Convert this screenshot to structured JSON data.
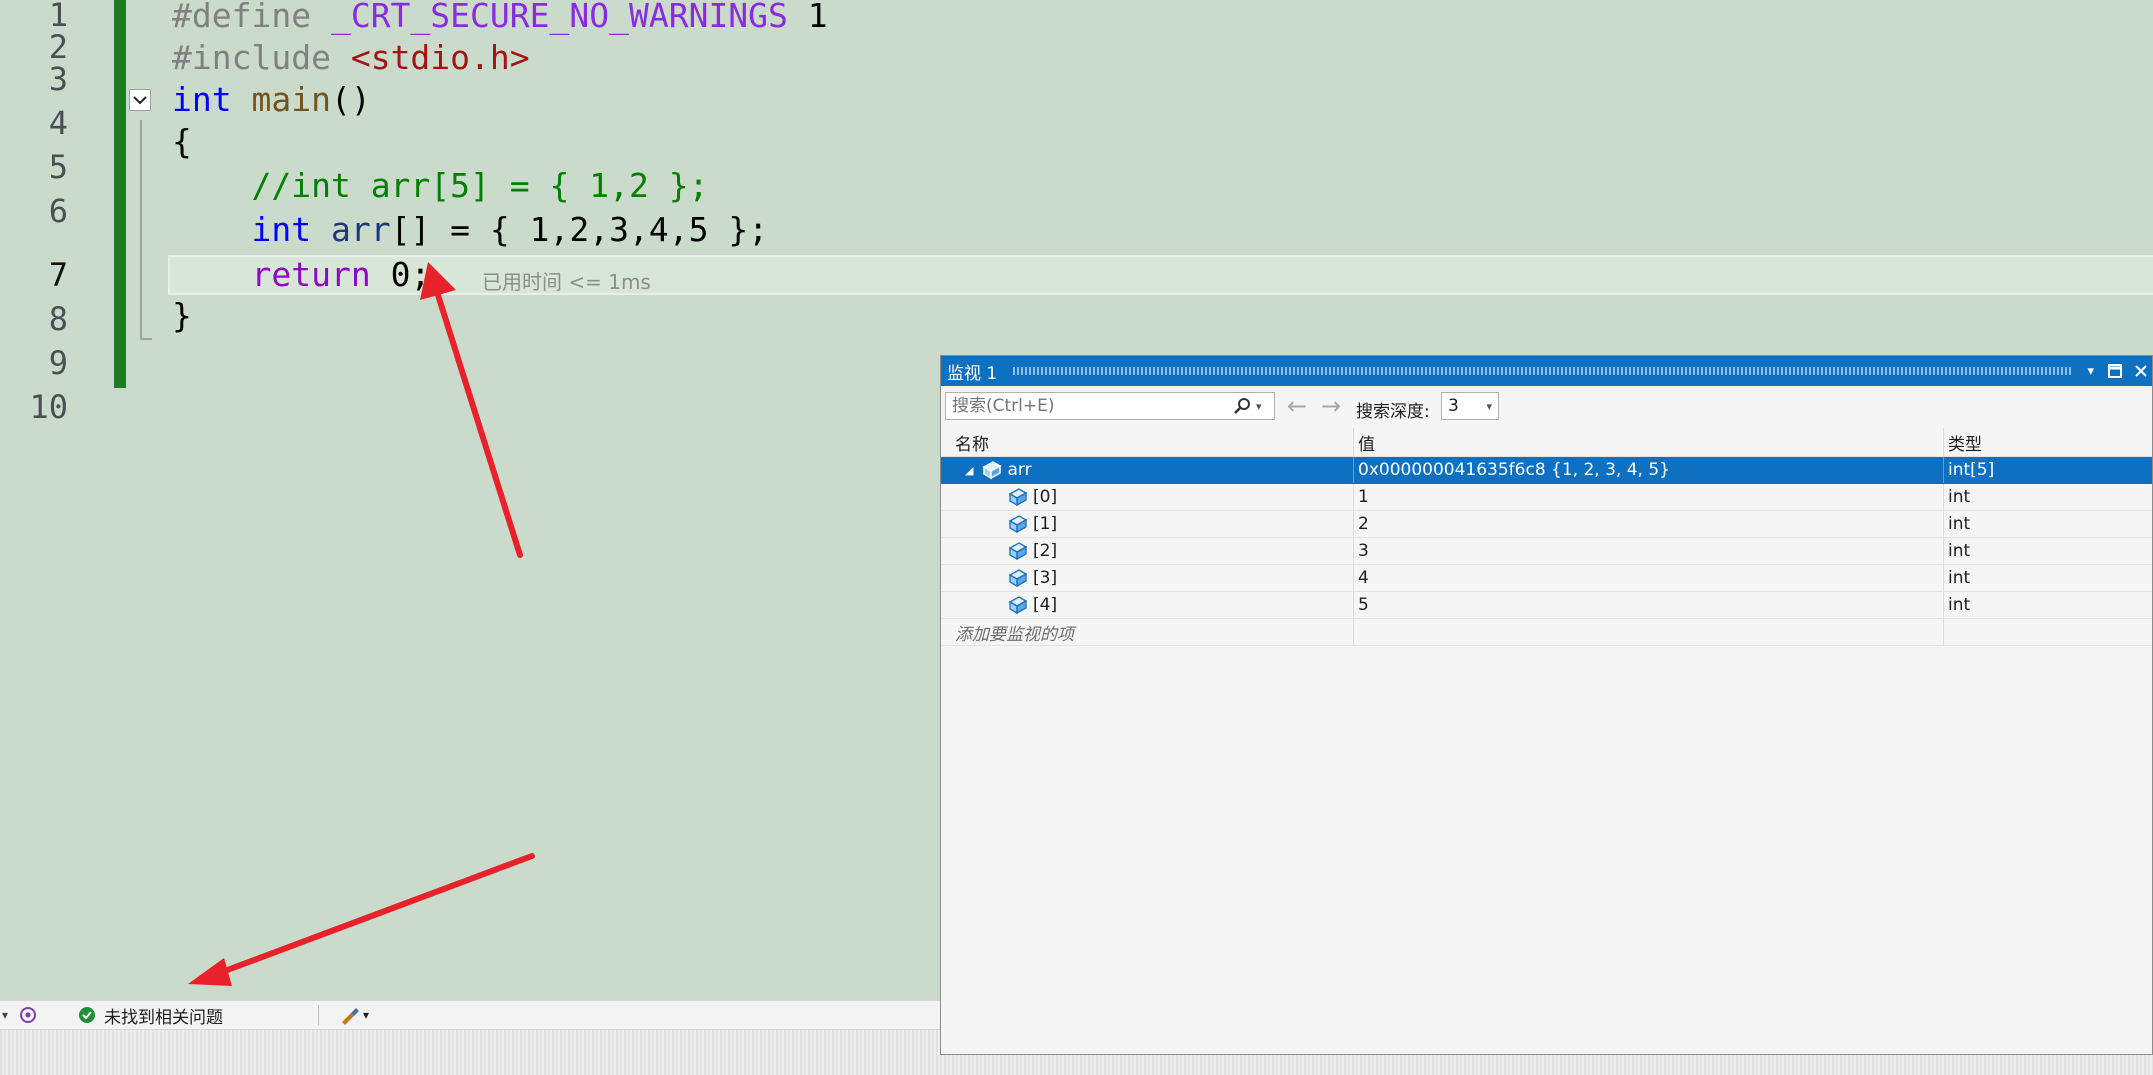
{
  "editor": {
    "line_numbers": [
      "1",
      "2",
      "3",
      "4",
      "5",
      "6",
      "7",
      "8",
      "9",
      "10"
    ],
    "current_line": "7",
    "code": {
      "l1_directive": "#define",
      "l1_macro": "_CRT_SECURE_NO_WARNINGS",
      "l1_value": "1",
      "l2_directive": "#include",
      "l2_header": "<stdio.h>",
      "l3_type": "int",
      "l3_func": "main",
      "l3_parens": "()",
      "l4": "{",
      "l5_comment": "//int arr[5] = { 1,2 };",
      "l6_type": "int",
      "l6_var": "arr",
      "l6_rest": "[] = { 1,2,3,4,5 };",
      "l7_keyword": "return",
      "l7_rest": "0;",
      "l8": "}"
    },
    "elapsed_hint": "已用时间 <= 1ms"
  },
  "status_bar": {
    "issues_text": "未找到相关问题"
  },
  "watch": {
    "title": "监视 1",
    "search_placeholder": "搜索(Ctrl+E)",
    "depth_label": "搜索深度:",
    "depth_value": "3",
    "columns": {
      "name": "名称",
      "value": "值",
      "type": "类型"
    },
    "root": {
      "name": "arr",
      "value": "0x000000041635f6c8 {1, 2, 3, 4, 5}",
      "type": "int[5]"
    },
    "children": [
      {
        "name": "[0]",
        "value": "1",
        "type": "int"
      },
      {
        "name": "[1]",
        "value": "2",
        "type": "int"
      },
      {
        "name": "[2]",
        "value": "3",
        "type": "int"
      },
      {
        "name": "[3]",
        "value": "4",
        "type": "int"
      },
      {
        "name": "[4]",
        "value": "5",
        "type": "int"
      }
    ],
    "add_item_hint": "添加要监视的项"
  },
  "colors": {
    "editor_bg": "#cbdbcb",
    "accent_blue": "#0e70c0",
    "annotation_red": "#e8212a",
    "change_bar_green": "#1e7d22"
  },
  "icons": [
    "chevron-down-icon",
    "object-icon",
    "search-icon",
    "back-arrow-icon",
    "forward-arrow-icon",
    "check-circle-icon",
    "brush-icon",
    "pin-icon",
    "maximize-icon",
    "close-icon",
    "collapse-triangle-icon"
  ]
}
